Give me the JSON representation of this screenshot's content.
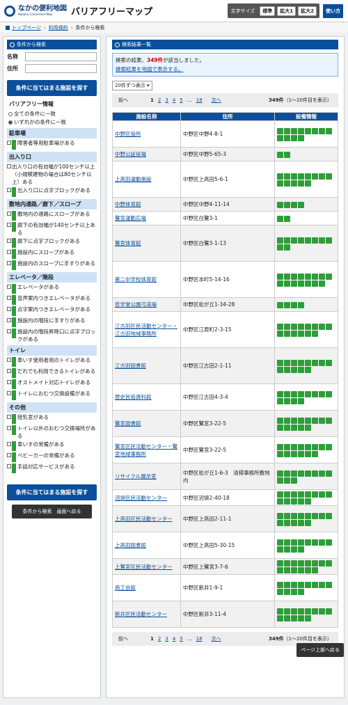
{
  "header": {
    "logo_ja": "なかの便利地図",
    "logo_en": "Nakano Convenient-Map",
    "title": "バリアフリーマップ",
    "fontsize_label": "文字サイズ",
    "font_buttons": [
      "標準",
      "拡大1",
      "拡大2"
    ],
    "howto": "使い方"
  },
  "breadcrumb": {
    "home": "トップページ",
    "terms": "利用規約",
    "current": "条件から検索"
  },
  "sidebar": {
    "heading": "条件から検索",
    "name_label": "名称",
    "address_label": "住所",
    "search_button": "条件に当てはまる施設を探す",
    "bf_heading": "バリアフリー情報",
    "match_all": "全ての条件に一致",
    "match_any": "いずれかの条件に一致",
    "cat_parking": "駐車場",
    "opt_parking": "障害者等用駐車場がある",
    "cat_entrance": "出入り口",
    "opt_entr1": "出入り口の有効幅が100センチ以上（小規模建物の場合は80センチ以上）ある",
    "opt_entr2": "出入り口に点字ブロックがある",
    "cat_corridor": "敷地内通路／廊下／スロープ",
    "opt_cor1": "敷地内の通路にスロープがある",
    "opt_cor2": "廊下の有効幅が140センチ以上ある",
    "opt_cor3": "廊下に点字ブロックがある",
    "opt_cor4": "施設内にスロープがある",
    "opt_cor5": "施設内のスロープに手すりがある",
    "cat_elev": "エレベータ／階段",
    "opt_el1": "エレベータがある",
    "opt_el2": "音声案内つきエレベータがある",
    "opt_el3": "点字案内つきエレベータがある",
    "opt_el4": "施設内の階段に手すりがある",
    "opt_el5": "施設内の階段昇降口に点字ブロックがある",
    "cat_toilet": "トイレ",
    "opt_t1": "車いす使用者用のトイレがある",
    "opt_t2": "だれでも利用できるトイレがある",
    "opt_t3": "オストメイト対応トイレがある",
    "opt_t4": "トイレにおむつ交換設備がある",
    "cat_other": "その他",
    "opt_o1": "授乳室がある",
    "opt_o2": "トイレ以外のおむつ交換場所がある",
    "opt_o3": "車いすの常備がある",
    "opt_o4": "ベビーカーの常備がある",
    "opt_o5": "手話対応サービスがある",
    "back_button": "条件から検索　画面へ戻る"
  },
  "main": {
    "heading": "検索結果一覧",
    "result_prefix": "検索の結果、",
    "result_count": "349件",
    "result_suffix": "が該当しました。",
    "map_link": "検索結果を地図で表示する。",
    "per_page": "20件ずつ表示",
    "pager": {
      "prev": "前へ",
      "pages": [
        "1",
        "2",
        "3",
        "4",
        "5"
      ],
      "ellipsis": "…",
      "last": "18",
      "next": "次へ",
      "total": "349件",
      "range": "（1〜20件目を表示）"
    },
    "columns": [
      "施設名称",
      "住所",
      "設備情報"
    ],
    "rows": [
      {
        "name": "中野区役所",
        "address": "中野区中野4-8-1",
        "icons": 12
      },
      {
        "name": "中野公証役場",
        "address": "中野区中野5-65-3",
        "icons": 2
      },
      {
        "name": "上高田運動施設",
        "address": "中野区上高田5-6-1",
        "icons": 13
      },
      {
        "name": "中野体育館",
        "address": "中野区中野4-11-14",
        "icons": 4
      },
      {
        "name": "鷺宮運動広場",
        "address": "中野区白鷺3-1",
        "icons": 2
      },
      {
        "name": "鷺宮体育館",
        "address": "中野区白鷺3-1-13",
        "icons": 10
      },
      {
        "name": "第二中学校体育館",
        "address": "中野区本町5-14-16",
        "icons": 15
      },
      {
        "name": "哲学堂公園弓道場",
        "address": "中野区松が丘1-34-28",
        "icons": 4
      },
      {
        "name": "江古田区民活動センター・江古田地域事務所",
        "address": "中野区江原町2-3-15",
        "icons": 14
      },
      {
        "name": "江古田図書館",
        "address": "中野区江古田2-1-11",
        "icons": 13
      },
      {
        "name": "歴史民俗資料館",
        "address": "中野区江古田4-3-4",
        "icons": 12
      },
      {
        "name": "鷺宮図書館",
        "address": "中野区鷺宮3-22-5",
        "icons": 13
      },
      {
        "name": "鷺宮区民活動センター・鷺宮地域事務所",
        "address": "中野区鷺宮3-22-5",
        "icons": 14
      },
      {
        "name": "リサイクル展示室",
        "address": "中野区松が丘1-6-3　清掃事務所敷地内",
        "icons": 11
      },
      {
        "name": "沼袋区民活動センター",
        "address": "中野区沼袋2-40-18",
        "icons": 13
      },
      {
        "name": "上高田区民活動センター",
        "address": "中野区上高田2-11-1",
        "icons": 13
      },
      {
        "name": "上高田図書館",
        "address": "中野区上高田5-30-15",
        "icons": 12
      },
      {
        "name": "上鷺宮区民活動センター",
        "address": "中野区上鷺宮3-7-6",
        "icons": 14
      },
      {
        "name": "商工会館",
        "address": "中野区新井1-9-1",
        "icons": 12
      },
      {
        "name": "新井区民活動センター",
        "address": "中野区新井3-11-4",
        "icons": 13
      }
    ],
    "page_top": "ページ上部へ戻る"
  },
  "colors": {
    "brand": "#0a4f9c",
    "equipment_icon": "#2e9d3a",
    "highlight": "#dd0000"
  }
}
